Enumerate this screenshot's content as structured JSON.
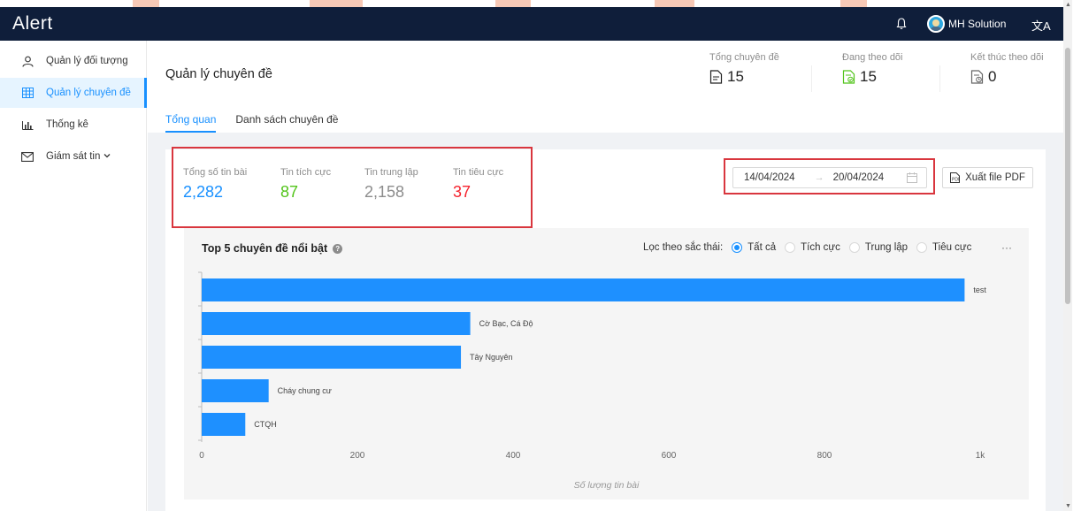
{
  "app": {
    "logo": "Alert"
  },
  "header": {
    "user_name": "MH Solution",
    "lang_icon": "translate-icon"
  },
  "sidebar": {
    "items": [
      {
        "label": "Quản lý đối tượng",
        "icon": "user-icon"
      },
      {
        "label": "Quản lý chuyên đề",
        "icon": "table-icon",
        "active": true
      },
      {
        "label": "Thống kê",
        "icon": "bar-chart-icon"
      },
      {
        "label": "Giám sát tin",
        "icon": "mail-icon"
      }
    ]
  },
  "page": {
    "title": "Quản lý chuyên đề",
    "stats": [
      {
        "label": "Tổng chuyên đề",
        "value": "15"
      },
      {
        "label": "Đang theo dõi",
        "value": "15"
      },
      {
        "label": "Kết thúc theo dõi",
        "value": "0"
      }
    ],
    "tabs": [
      {
        "label": "Tổng quan",
        "active": true
      },
      {
        "label": "Danh sách chuyên đề"
      }
    ]
  },
  "summary": [
    {
      "label": "Tổng số tin bài",
      "value": "2,282",
      "color": "#1890ff"
    },
    {
      "label": "Tin tích cực",
      "value": "87",
      "color": "#52c41a"
    },
    {
      "label": "Tin trung lập",
      "value": "2,158",
      "color": "#8c8c8c"
    },
    {
      "label": "Tin tiêu cực",
      "value": "37",
      "color": "#f5222d"
    }
  ],
  "date_range": {
    "start": "14/04/2024",
    "end": "20/04/2024",
    "arrow": "→"
  },
  "export_label": "Xuất file PDF",
  "chart_panel": {
    "title": "Top 5 chuyên đề nổi bật",
    "filter_label": "Lọc theo sắc thái:",
    "filter_options": [
      {
        "label": "Tất cả",
        "checked": true
      },
      {
        "label": "Tích cực"
      },
      {
        "label": "Trung lập"
      },
      {
        "label": "Tiêu cực"
      }
    ],
    "more": "···",
    "xlabel": "Số lượng tin bài"
  },
  "chart_data": {
    "type": "bar",
    "orientation": "horizontal",
    "categories": [
      "test",
      "Cờ Bạc, Cá Độ",
      "Tây Nguyên",
      "Cháy chung cư",
      "CTQH"
    ],
    "values": [
      980,
      345,
      333,
      86,
      56
    ],
    "xlabel": "Số lượng tin bài",
    "xlim": [
      0,
      1000
    ],
    "xticks": [
      "0",
      "200",
      "400",
      "600",
      "800",
      "1k"
    ],
    "bar_color": "#1e90ff",
    "grid": true
  }
}
